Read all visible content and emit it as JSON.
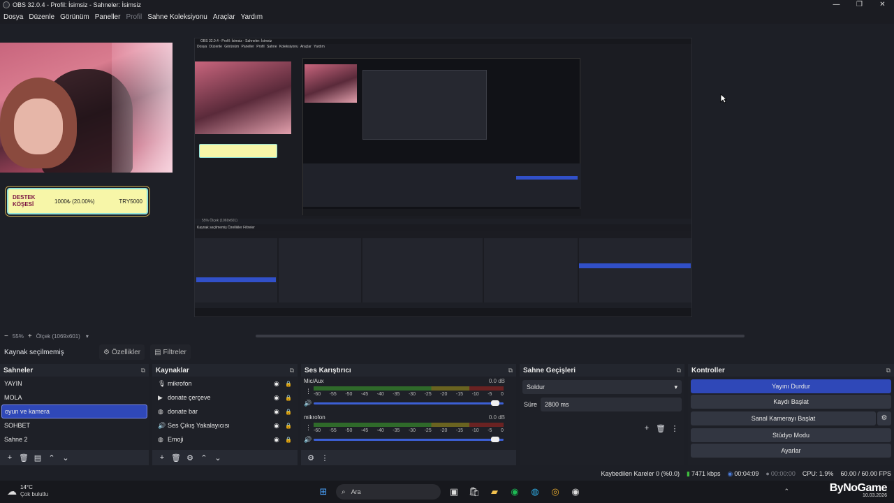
{
  "window": {
    "title": "OBS 32.0.4 - Profil: İsimsiz - Sahneler: İsimsiz",
    "controls": [
      "—",
      "❐",
      "✕"
    ]
  },
  "menu": [
    "Dosya",
    "Düzenle",
    "Görünüm",
    "Paneller",
    "Profil",
    "Sahne Koleksiyonu",
    "Araçlar",
    "Yardım"
  ],
  "preview": {
    "donate": {
      "label": "DESTEK KÖŞESİ",
      "amount": "1000₺ (20.00%)",
      "goal": "TRY5000"
    },
    "nested": {
      "title": "OBS 32.0.4 - Profil: İsimsiz - Sahneler: İsimsiz",
      "menu": "Dosya Düzenle Görünüm Paneller Profil Sahne Koleksiyonu Araçlar Yardım",
      "strip": "55%   Ölçek (1069x601)",
      "bar": "Kaynak seçilmemiş     Özellikler     Filtreler"
    }
  },
  "zoom": {
    "minus": "−",
    "value": "55%",
    "plus": "+",
    "scale": "Ölçek (1069x601)"
  },
  "context": {
    "label": "Kaynak seçilmemiş",
    "properties": "Özellikler",
    "filters": "Filtreler"
  },
  "scenes": {
    "title": "Sahneler",
    "items": [
      "YAYIN",
      "MOLA",
      "oyun ve kamera",
      "SOHBET",
      "Sahne 2"
    ],
    "active_index": 2
  },
  "sources": {
    "title": "Kaynaklar",
    "items": [
      {
        "name": "mikrofon",
        "icon": "microphone-icon"
      },
      {
        "name": "donate çerçeve",
        "icon": "play-icon"
      },
      {
        "name": "donate bar",
        "icon": "globe-icon"
      },
      {
        "name": "Ses Çıkış Yakalayıcısı",
        "icon": "speaker-icon"
      },
      {
        "name": "Emoji",
        "icon": "globe-icon"
      }
    ]
  },
  "mixer": {
    "title": "Ses Karıştırıcı",
    "scale": [
      "-60",
      "-55",
      "-50",
      "-45",
      "-40",
      "-35",
      "-30",
      "-25",
      "-20",
      "-15",
      "-10",
      "-5",
      "0"
    ],
    "channels": [
      {
        "name": "Mic/Aux",
        "db": "0.0 dB",
        "level": 1.0
      },
      {
        "name": "mikrofon",
        "db": "0.0 dB",
        "level": 1.0
      }
    ]
  },
  "transitions": {
    "title": "Sahne Geçişleri",
    "selected": "Soldur",
    "duration_label": "Süre",
    "duration_value": "2800 ms"
  },
  "controls": {
    "title": "Kontroller",
    "stop_stream": "Yayını Durdur",
    "start_record": "Kaydı Başlat",
    "virtual_cam": "Sanal Kamerayı Başlat",
    "studio_mode": "Stüdyo Modu",
    "settings": "Ayarlar"
  },
  "status": {
    "dropped": "Kaybedilen Kareler 0 (%0.0)",
    "bitrate": "7471 kbps",
    "stream_time": "00:04:09",
    "rec_time": "00:00:00",
    "cpu": "CPU: 1.9%",
    "fps": "60.00 / 60.00 FPS"
  },
  "taskbar": {
    "temp": "14°C",
    "weather": "Çok bulutlu",
    "search": "Ara",
    "brand": "ByNoGame",
    "date": "10.03.2026",
    "tray": "⌃"
  },
  "colors": {
    "accent": "#2f48b8",
    "panel": "#272a33",
    "bg": "#1d1f26"
  }
}
